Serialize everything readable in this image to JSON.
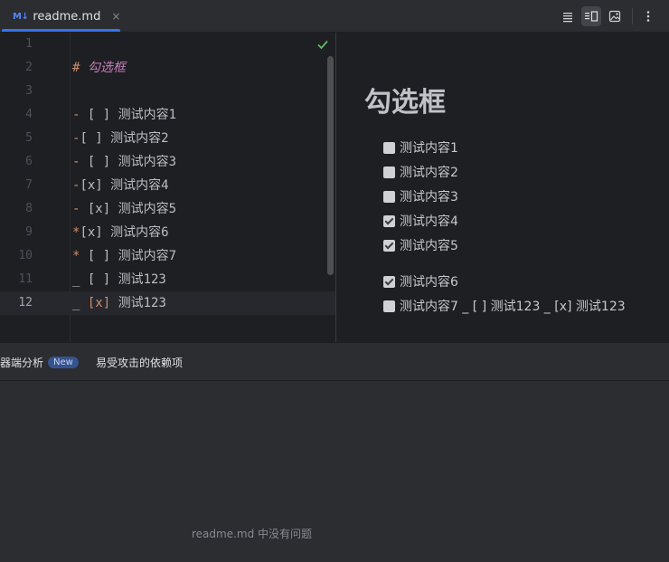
{
  "tab": {
    "icon": "M↓",
    "label": "readme.md",
    "close": "×"
  },
  "editor": {
    "lines": [
      {
        "n": "1",
        "parts": []
      },
      {
        "n": "2",
        "parts": [
          [
            "marker",
            "# "
          ],
          [
            "heading",
            "勾选框"
          ]
        ]
      },
      {
        "n": "3",
        "parts": []
      },
      {
        "n": "4",
        "parts": [
          [
            "marker",
            "- "
          ],
          [
            "text",
            "[ ] 测试内容1"
          ]
        ]
      },
      {
        "n": "5",
        "parts": [
          [
            "marker",
            "-"
          ],
          [
            "text",
            "[ ] 测试内容2"
          ]
        ]
      },
      {
        "n": "6",
        "parts": [
          [
            "marker",
            "- "
          ],
          [
            "text",
            "[ ] 测试内容3"
          ]
        ]
      },
      {
        "n": "7",
        "parts": [
          [
            "marker",
            "-"
          ],
          [
            "text",
            "[x] 测试内容4"
          ]
        ]
      },
      {
        "n": "8",
        "parts": [
          [
            "marker",
            "- "
          ],
          [
            "text",
            "[x] 测试内容5"
          ]
        ]
      },
      {
        "n": "9",
        "parts": [
          [
            "marker",
            "*"
          ],
          [
            "text",
            "[x] 测试内容6"
          ]
        ]
      },
      {
        "n": "10",
        "parts": [
          [
            "marker",
            "* "
          ],
          [
            "text",
            "[ ] 测试内容7"
          ]
        ]
      },
      {
        "n": "11",
        "parts": [
          [
            "text",
            "_ [ ] 测试123"
          ]
        ]
      },
      {
        "n": "12",
        "parts": [
          [
            "text",
            "_ "
          ],
          [
            "x",
            "[x]"
          ],
          [
            "text",
            " 测试123"
          ]
        ]
      }
    ],
    "current_line": 12
  },
  "preview": {
    "title": "勾选框",
    "items": [
      {
        "label": "测试内容1",
        "checked": false
      },
      {
        "label": "测试内容2",
        "checked": false
      },
      {
        "label": "测试内容3",
        "checked": false
      },
      {
        "label": "测试内容4",
        "checked": true
      },
      {
        "label": "测试内容5",
        "checked": true
      },
      {
        "label": "测试内容6",
        "checked": true
      },
      {
        "label": "测试内容7 _ [ ] 测试123 _ [x] 测试123",
        "checked": false
      }
    ]
  },
  "panel": {
    "tab1_label": "器端分析",
    "tab1_badge": "New",
    "tab2_label": "易受攻击的依赖项",
    "empty_message": "readme.md 中没有问题"
  },
  "colors": {
    "accent": "#3574f0",
    "success": "#5fb865",
    "marker": "#cf8e6d",
    "heading": "#c77dbb"
  }
}
